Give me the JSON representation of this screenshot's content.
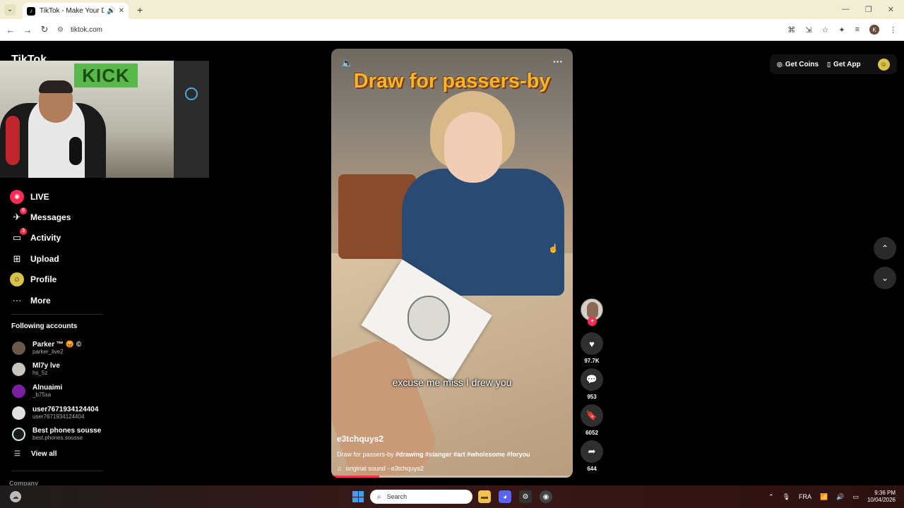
{
  "browser": {
    "tab_title": "TikTok - Make Your Day",
    "url": "tiktok.com"
  },
  "sidebar": {
    "logo": "TikTok",
    "webcam_sign": "KICK",
    "nav": [
      {
        "label": "LIVE",
        "icon": "live-icon",
        "badge": ""
      },
      {
        "label": "Messages",
        "icon": "messages-icon",
        "badge": "6"
      },
      {
        "label": "Activity",
        "icon": "activity-icon",
        "badge": "3"
      },
      {
        "label": "Upload",
        "icon": "upload-icon",
        "badge": ""
      },
      {
        "label": "Profile",
        "icon": "profile-icon",
        "badge": ""
      },
      {
        "label": "More",
        "icon": "more-icon",
        "badge": ""
      }
    ],
    "following_title": "Following accounts",
    "accounts": [
      {
        "name": "Parker ™ 😡 ©",
        "handle": "parker_live2",
        "color": "#6b5a4a"
      },
      {
        "name": "Ml7y lve",
        "handle": "hs_5z",
        "color": "#c8c4c0"
      },
      {
        "name": "Alnuaimi",
        "handle": "_b75xa",
        "color": "#7b1fa2"
      },
      {
        "name": "user7671934124404",
        "handle": "user7671934124404",
        "color": "#e0e0e0"
      },
      {
        "name": "Best phones sousse",
        "handle": "best.phones.sousse",
        "color": "#1a1a1a"
      }
    ],
    "view_all": "View all",
    "company": "Company"
  },
  "video": {
    "overlay_title": "Draw for passers-by",
    "caption": "excuse me miss I drew you",
    "author": "e3tchquys2",
    "description": "Draw for passers-by",
    "hashtags": "#drawing #stanger #art #wholesome #foryou",
    "sound": "original sound - e3tchquys2",
    "progress": 0.2
  },
  "actions": {
    "likes": "97.7K",
    "comments": "953",
    "saves": "6052",
    "shares": "644"
  },
  "topright": {
    "get_coins": "Get Coins",
    "get_app": "Get App"
  },
  "taskbar": {
    "search_placeholder": "Search",
    "language": "FRA",
    "time": "9:36 PM",
    "date": "10/04/2026"
  }
}
